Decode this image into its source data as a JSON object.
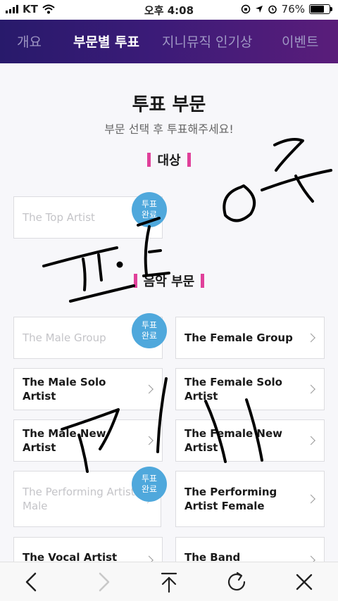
{
  "status_bar": {
    "carrier": "KT",
    "time": "오후 4:08",
    "battery": "76%",
    "battery_level": 0.76
  },
  "nav": {
    "tabs": [
      {
        "label": "개요",
        "active": false
      },
      {
        "label": "부문별 투표",
        "active": true
      },
      {
        "label": "지니뮤직 인기상",
        "active": false
      },
      {
        "label": "이벤트",
        "active": false
      }
    ]
  },
  "page": {
    "title": "투표 부문",
    "subtitle": "부문 선택 후 투표해주세요!",
    "sections": [
      {
        "title": "대상"
      },
      {
        "title": "음악 부문"
      }
    ]
  },
  "badge_text": {
    "line1": "투표",
    "line2": "완료"
  },
  "categories": {
    "grand": [
      {
        "label": "The Top Artist",
        "voted": true
      }
    ],
    "music": [
      {
        "label": "The Male Group",
        "voted": true
      },
      {
        "label": "The Female Group",
        "voted": false
      },
      {
        "label": "The Male Solo Artist",
        "voted": false
      },
      {
        "label": "The Female Solo Artist",
        "voted": false
      },
      {
        "label": "The Male New Artist",
        "voted": false
      },
      {
        "label": "The Female New Artist",
        "voted": false
      },
      {
        "label": "The Performing Artist Male",
        "voted": true
      },
      {
        "label": "The Performing Artist Female",
        "voted": false
      },
      {
        "label": "The Vocal Artist",
        "voted": false
      },
      {
        "label": "The Band",
        "voted": false
      }
    ]
  },
  "toolbar": {
    "icons": [
      "back-icon",
      "forward-icon",
      "share-icon",
      "reload-icon",
      "close-icon"
    ]
  },
  "colors": {
    "nav_gradient_start": "#281a6b",
    "nav_gradient_end": "#5a1d7a",
    "section_bar": "#e0409a",
    "badge": "#4fa8dc"
  }
}
